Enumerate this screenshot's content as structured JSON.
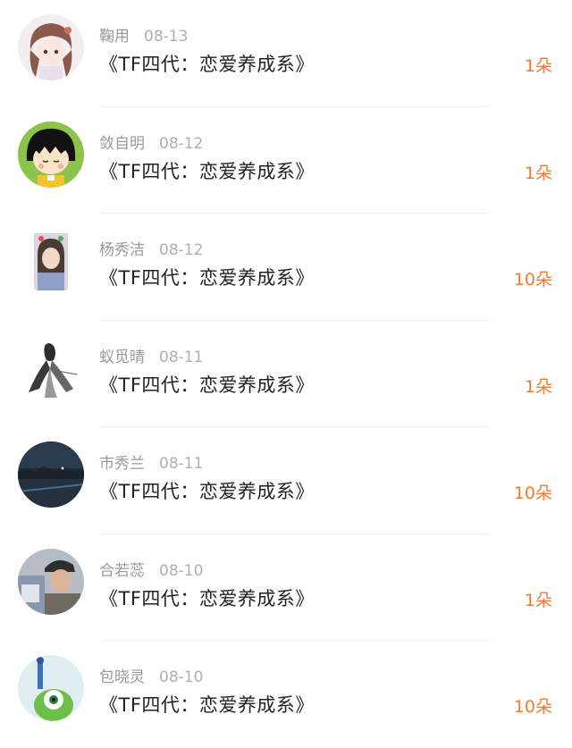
{
  "gifts": [
    {
      "name": "鞠用",
      "date": "08-13",
      "title": "《TF四代：恋爱养成系》",
      "count": "1朵",
      "avatar": "anime-girl"
    },
    {
      "name": "敛自明",
      "date": "08-12",
      "title": "《TF四代：恋爱养成系》",
      "count": "1朵",
      "avatar": "cartoon-girl"
    },
    {
      "name": "杨秀洁",
      "date": "08-12",
      "title": "《TF四代：恋爱养成系》",
      "count": "10朵",
      "avatar": "photo-portrait"
    },
    {
      "name": "蚁觅晴",
      "date": "08-11",
      "title": "《TF四代：恋爱养成系》",
      "count": "1朵",
      "avatar": "ink-figure"
    },
    {
      "name": "市秀兰",
      "date": "08-11",
      "title": "《TF四代：恋爱养成系》",
      "count": "10朵",
      "avatar": "night-landscape"
    },
    {
      "name": "合若蕊",
      "date": "08-10",
      "title": "《TF四代：恋爱养成系》",
      "count": "1朵",
      "avatar": "man-photo"
    },
    {
      "name": "包晓灵",
      "date": "08-10",
      "title": "《TF四代：恋爱养成系》",
      "count": "10朵",
      "avatar": "green-monster"
    }
  ],
  "colors": {
    "accent": "#f57a2d",
    "name": "#9a9a9a",
    "title": "#222222"
  }
}
